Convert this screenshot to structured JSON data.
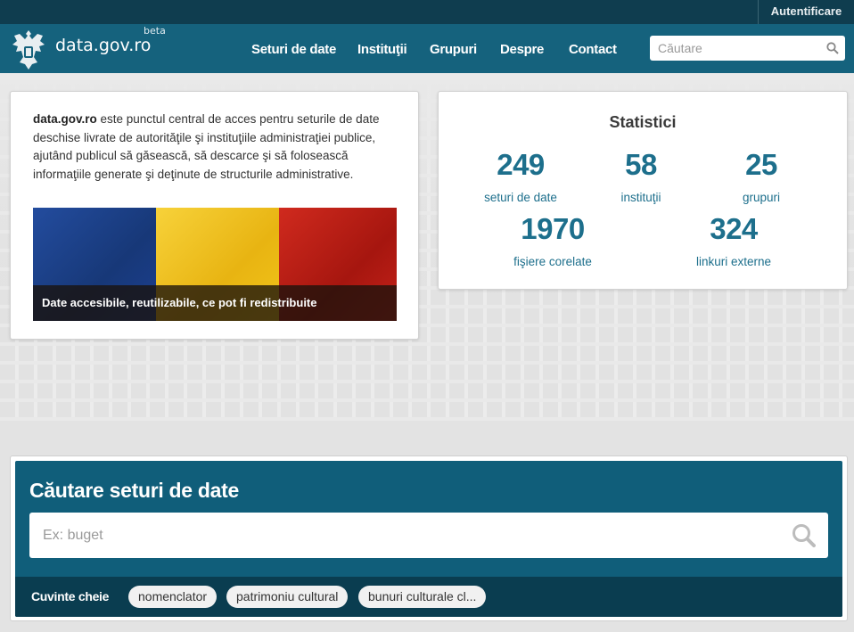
{
  "topbar": {
    "login_label": "Autentificare"
  },
  "brand": {
    "name": "data.gov.ro",
    "badge": "beta"
  },
  "nav": {
    "items": [
      {
        "label": "Seturi de date"
      },
      {
        "label": "Instituţii"
      },
      {
        "label": "Grupuri"
      },
      {
        "label": "Despre"
      },
      {
        "label": "Contact"
      }
    ],
    "search_placeholder": "Căutare"
  },
  "intro": {
    "brand": "data.gov.ro",
    "text": " este punctul central de acces pentru seturile de date deschise livrate de autorităţile şi instituţiile administraţiei publice, ajutând publicul să găsească, să descarce şi să folosească informaţiile generate şi deţinute de structurile administrative.",
    "banner_caption": "Date accesibile, reutilizabile, ce pot fi redistribuite",
    "flag_colors": [
      "#1c3f8f",
      "#f2c419",
      "#c4221a"
    ]
  },
  "stats": {
    "title": "Statistici",
    "items": [
      {
        "value": "249",
        "label": "seturi de date"
      },
      {
        "value": "58",
        "label": "instituţii"
      },
      {
        "value": "25",
        "label": "grupuri"
      },
      {
        "value": "1970",
        "label": "fişiere corelate"
      },
      {
        "value": "324",
        "label": "linkuri externe"
      }
    ]
  },
  "dataset_search": {
    "title": "Căutare seturi de date",
    "placeholder": "Ex: buget",
    "keywords_label": "Cuvinte cheie",
    "keywords": [
      "nomenclator",
      "patrimoniu cultural",
      "bunuri culturale cl..."
    ]
  },
  "colors": {
    "primary": "#15627d",
    "dark": "#0f3d4f",
    "accent": "#1d6f8c"
  }
}
